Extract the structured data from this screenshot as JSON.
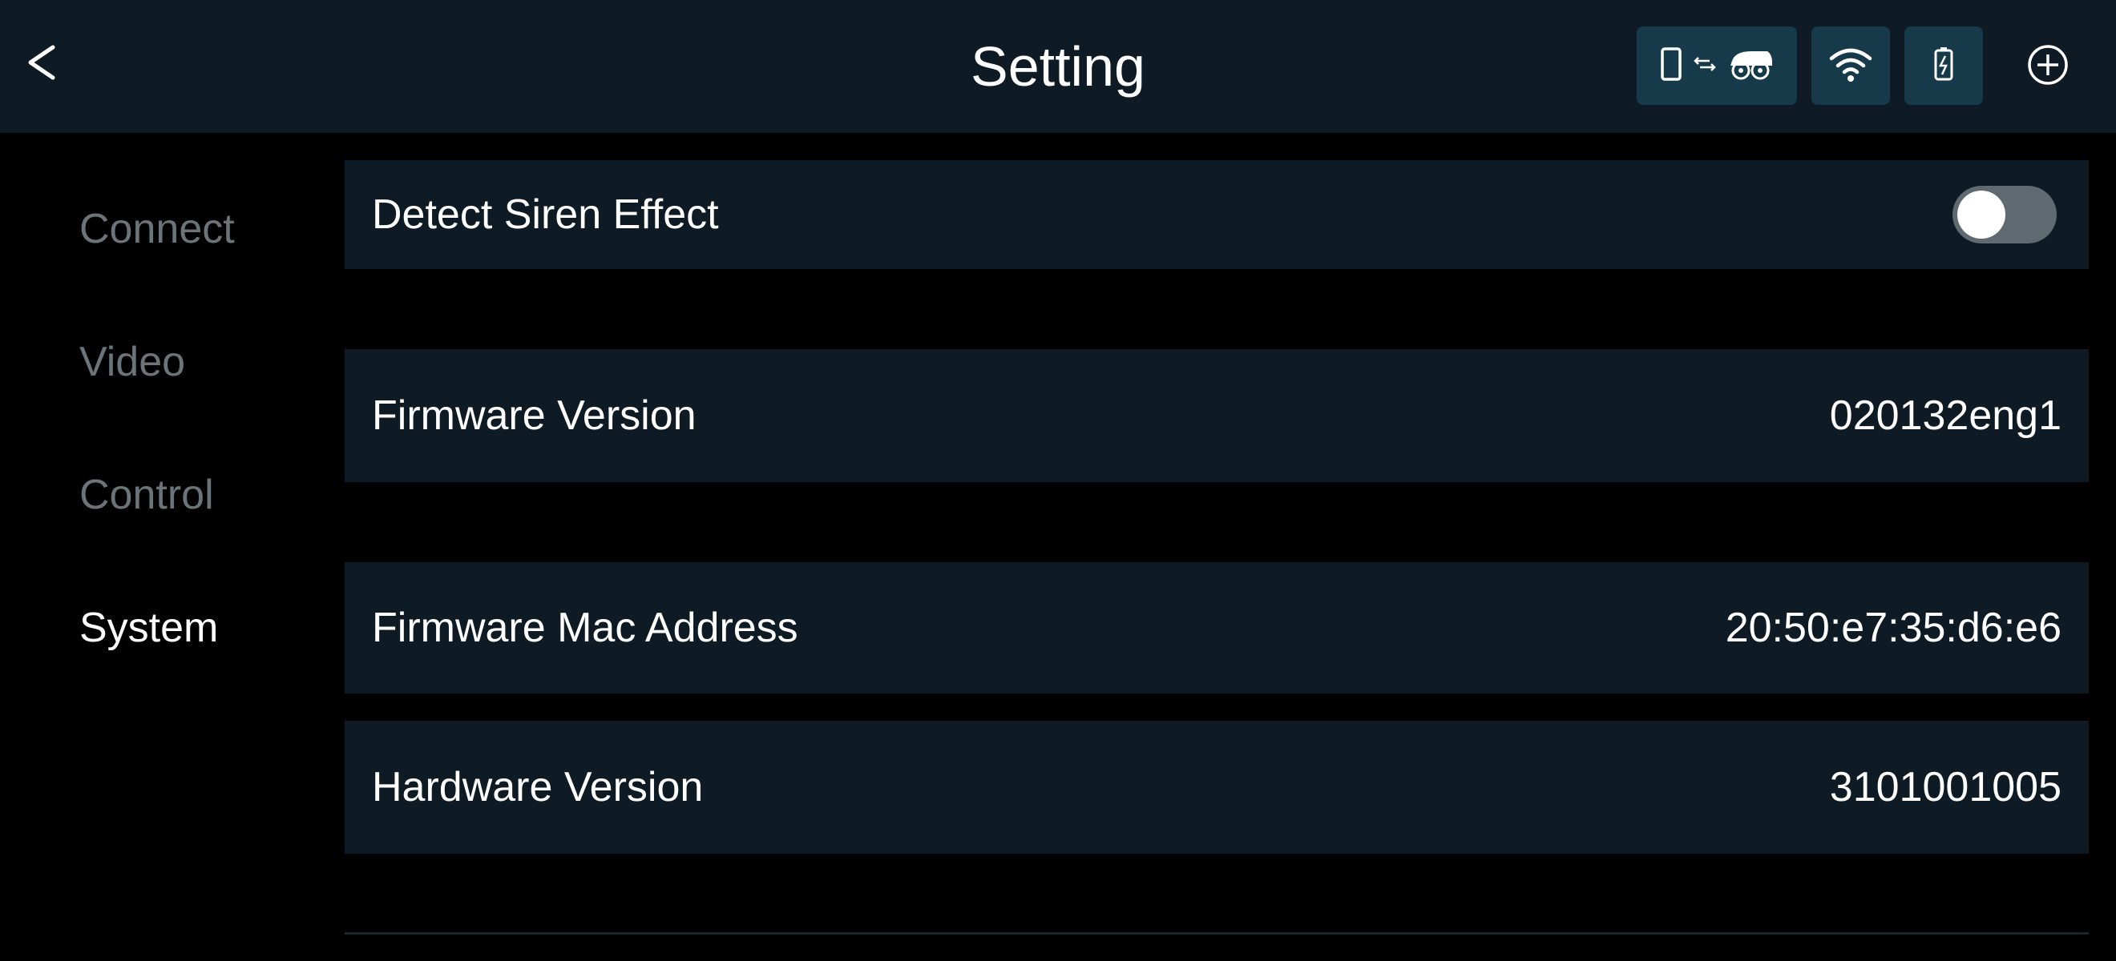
{
  "header": {
    "back_label": "<",
    "title": "Setting",
    "icons": {
      "back": "back-chevron-icon",
      "phone": "phone-icon",
      "transfer": "swap-arrows-icon",
      "device": "robot-device-icon",
      "wifi": "wifi-icon",
      "battery": "battery-charging-icon",
      "add": "add-circle-icon"
    }
  },
  "sidebar": {
    "items": [
      {
        "label": "Connect",
        "active": false
      },
      {
        "label": "Video",
        "active": false
      },
      {
        "label": "Control",
        "active": false
      },
      {
        "label": "System",
        "active": true
      }
    ]
  },
  "settings": {
    "siren": {
      "label": "Detect Siren Effect",
      "enabled": false
    },
    "firmware_version": {
      "label": "Firmware Version",
      "value": "020132eng1"
    },
    "mac_address": {
      "label": "Firmware Mac Address",
      "value": "20:50:e7:35:d6:e6"
    },
    "hardware_version": {
      "label": "Hardware Version",
      "value": "3101001005"
    }
  },
  "colors": {
    "background": "#000000",
    "bar": "#0f1b24",
    "chip": "#173a4a",
    "inactive_text": "#6b7479",
    "toggle_off": "#5e6a70"
  }
}
